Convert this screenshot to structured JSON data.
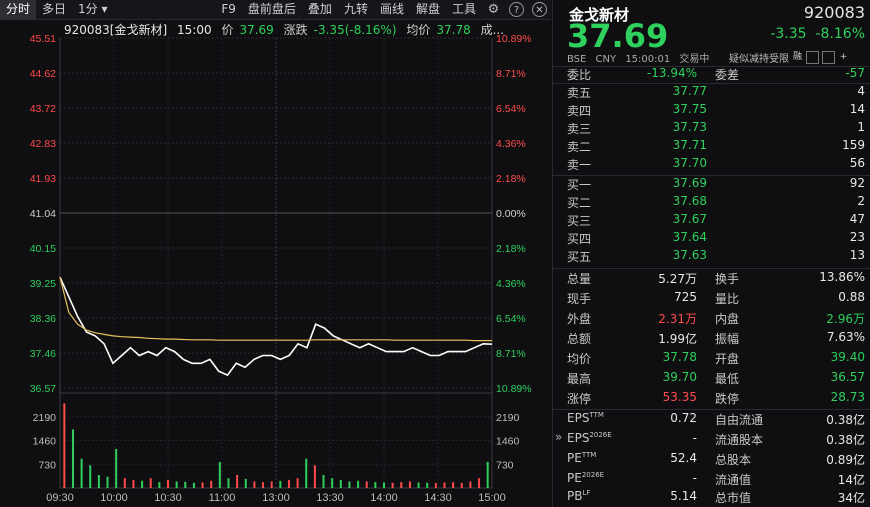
{
  "toolbar": {
    "left_tabs": [
      "分时",
      "多日",
      "1分"
    ],
    "left_more": "▾",
    "right_tabs": [
      "F9",
      "盘前盘后",
      "叠加",
      "九转",
      "画线",
      "解盘",
      "工具"
    ],
    "icons": [
      "gear-icon",
      "help-icon",
      "close-icon"
    ]
  },
  "info_bar": {
    "code_name": "920083[金戈新材]",
    "time": "15:00",
    "price_label": "价",
    "price": "37.69",
    "chg_label": "涨跌",
    "chg": "-3.35(-8.16%)",
    "avg_label": "均价",
    "avg": "37.78",
    "vol_label": "成..."
  },
  "chart_data": {
    "type": "line",
    "title": "",
    "prev_close": 41.04,
    "price_axis": [
      "45.51",
      "44.62",
      "43.72",
      "42.83",
      "41.93",
      "41.04",
      "40.15",
      "39.25",
      "38.36",
      "37.46",
      "36.57"
    ],
    "pct_axis": [
      "10.89%",
      "8.71%",
      "6.54%",
      "4.36%",
      "2.18%",
      "0.00%",
      "2.18%",
      "4.36%",
      "6.54%",
      "8.71%",
      "10.89%"
    ],
    "ylim": [
      36.57,
      45.51
    ],
    "vol_axis": [
      "2190",
      "1460",
      "730"
    ],
    "vol_ylim": [
      0,
      2920
    ],
    "time_labels": [
      "09:30",
      "10:00",
      "10:30",
      "11:00",
      "13:00",
      "13:30",
      "14:00",
      "14:30",
      "15:00"
    ],
    "series": [
      {
        "values": [
          39.4,
          38.9,
          38.4,
          38.0,
          37.9,
          37.7,
          37.2,
          37.4,
          37.6,
          37.4,
          37.5,
          37.4,
          37.6,
          37.5,
          37.3,
          37.2,
          37.2,
          37.3,
          37.0,
          36.9,
          37.2,
          37.1,
          37.3,
          37.4,
          37.4,
          37.3,
          37.4,
          37.7,
          37.6,
          38.2,
          38.1,
          37.9,
          37.8,
          37.7,
          37.6,
          37.7,
          37.6,
          37.5,
          37.5,
          37.5,
          37.6,
          37.5,
          37.4,
          37.4,
          37.5,
          37.5,
          37.5,
          37.6,
          37.7,
          37.69
        ],
        "color": "#ffffff"
      },
      {
        "values": [
          39.4,
          38.5,
          38.2,
          38.05,
          37.98,
          37.94,
          37.9,
          37.88,
          37.87,
          37.86,
          37.84,
          37.83,
          37.82,
          37.82,
          37.81,
          37.8,
          37.8,
          37.8,
          37.79,
          37.79,
          37.79,
          37.79,
          37.79,
          37.79,
          37.79,
          37.79,
          37.79,
          37.79,
          37.79,
          37.8,
          37.8,
          37.8,
          37.8,
          37.8,
          37.8,
          37.8,
          37.8,
          37.8,
          37.79,
          37.79,
          37.79,
          37.79,
          37.79,
          37.79,
          37.79,
          37.79,
          37.79,
          37.78,
          37.78,
          37.78
        ],
        "color": "#e6c35a"
      }
    ],
    "volume": [
      2600,
      1800,
      900,
      700,
      400,
      350,
      1200,
      300,
      250,
      220,
      300,
      180,
      250,
      200,
      190,
      160,
      170,
      220,
      800,
      300,
      400,
      280,
      200,
      180,
      200,
      220,
      250,
      300,
      900,
      700,
      400,
      300,
      250,
      200,
      220,
      200,
      180,
      170,
      160,
      180,
      200,
      170,
      160,
      150,
      170,
      180,
      160,
      200,
      300,
      800
    ]
  },
  "quote": {
    "name": "金戈新材",
    "code": "920083",
    "price": "37.69",
    "change": "-3.35",
    "change_pct": "-8.16%",
    "meta": [
      "BSE",
      "CNY",
      "15:00:01",
      "交易中"
    ],
    "flags_label": "疑似减持受限",
    "flags_icons": [
      "融",
      "☐",
      "☐",
      "+"
    ],
    "wei_bi_label": "委比",
    "wei_bi": "-13.94%",
    "wei_cha_label": "委差",
    "wei_cha": "-57",
    "asks": [
      {
        "label": "卖五",
        "price": "37.77",
        "vol": "4"
      },
      {
        "label": "卖四",
        "price": "37.75",
        "vol": "14"
      },
      {
        "label": "卖三",
        "price": "37.73",
        "vol": "1"
      },
      {
        "label": "卖二",
        "price": "37.71",
        "vol": "159"
      },
      {
        "label": "卖一",
        "price": "37.70",
        "vol": "56"
      }
    ],
    "bids": [
      {
        "label": "买一",
        "price": "37.69",
        "vol": "92"
      },
      {
        "label": "买二",
        "price": "37.68",
        "vol": "2"
      },
      {
        "label": "买三",
        "price": "37.67",
        "vol": "47"
      },
      {
        "label": "买四",
        "price": "37.64",
        "vol": "23"
      },
      {
        "label": "买五",
        "price": "37.63",
        "vol": "13"
      }
    ],
    "stats": [
      [
        "总量",
        "5.27万",
        "换手",
        "13.86%"
      ],
      [
        "现手",
        "725",
        "量比",
        "0.88"
      ],
      [
        "外盘",
        "2.31万",
        "内盘",
        "2.96万"
      ],
      [
        "总额",
        "1.99亿",
        "振幅",
        "7.63%"
      ],
      [
        "均价",
        "37.78",
        "开盘",
        "39.40"
      ],
      [
        "最高",
        "39.70",
        "最低",
        "36.57"
      ],
      [
        "涨停",
        "53.35",
        "跌停",
        "28.73"
      ]
    ],
    "fund": [
      [
        "EPS",
        "TTM",
        "0.72",
        "自由流通",
        "0.38亿"
      ],
      [
        "EPS",
        "2026E",
        "-",
        "流通股本",
        "0.38亿"
      ],
      [
        "PE",
        "TTM",
        "52.4",
        "总股本",
        "0.89亿"
      ],
      [
        "PE",
        "2026E",
        "-",
        "流通值",
        "14亿"
      ],
      [
        "PB",
        "LF",
        "5.14",
        "总市值",
        "34亿"
      ]
    ],
    "collapse_arrow": "»"
  },
  "colors": {
    "up": "#ff4b4b",
    "down": "#2fd05c",
    "avg": "#e6c35a",
    "price": "#ffffff"
  }
}
